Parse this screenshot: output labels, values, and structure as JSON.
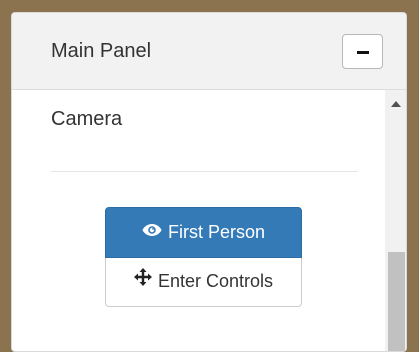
{
  "panel": {
    "title": "Main Panel",
    "collapse_button": "minus-icon"
  },
  "section": {
    "title": "Camera"
  },
  "buttons": {
    "first_person": {
      "label": "First Person",
      "icon": "eye-icon",
      "color": "#337ab7"
    },
    "enter_controls": {
      "label": "Enter Controls",
      "icon": "move-arrows-icon"
    }
  },
  "colors": {
    "background": "#8b7350",
    "primary": "#337ab7",
    "header_bg": "#f2f2f2"
  }
}
